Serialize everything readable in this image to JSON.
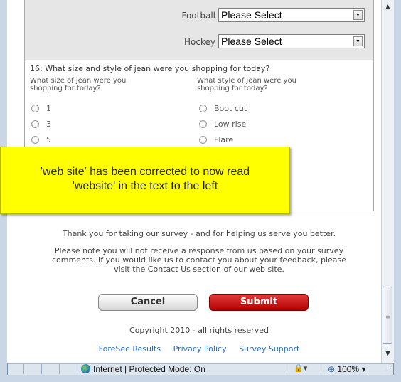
{
  "sports": [
    {
      "label": "Football",
      "value": "Please Select"
    },
    {
      "label": "Hockey",
      "value": "Please Select"
    }
  ],
  "question": {
    "title": "16: What size and style of jean were you shopping for today?",
    "size_header": "What size of jean were you shopping for today?",
    "style_header": "What style of jean were you shopping for today?",
    "sizes": [
      "1",
      "3",
      "5"
    ],
    "styles": [
      "Boot cut",
      "Low rise",
      "Flare"
    ]
  },
  "callout": {
    "line1": "'web site' has been corrected to now read",
    "line2": "'website' in the text to the left"
  },
  "thanks": "Thank you for taking our survey - and for helping us serve you better.",
  "disclaimer": "Please note you will not receive a response from us based on your survey comments. If you would like us to contact you about your feedback, please visit the Contact Us section of our web site.",
  "buttons": {
    "cancel": "Cancel",
    "submit": "Submit"
  },
  "copyright": "Copyright 2010 - all rights reserved",
  "links": [
    "ForeSee Results",
    "Privacy Policy",
    "Survey Support"
  ],
  "statusbar": {
    "zone": "Internet | Protected Mode: On",
    "zoom": "100%"
  },
  "colors": {
    "submit": "#c00000",
    "callout": "#ffff00",
    "link": "#2a6ebb"
  }
}
